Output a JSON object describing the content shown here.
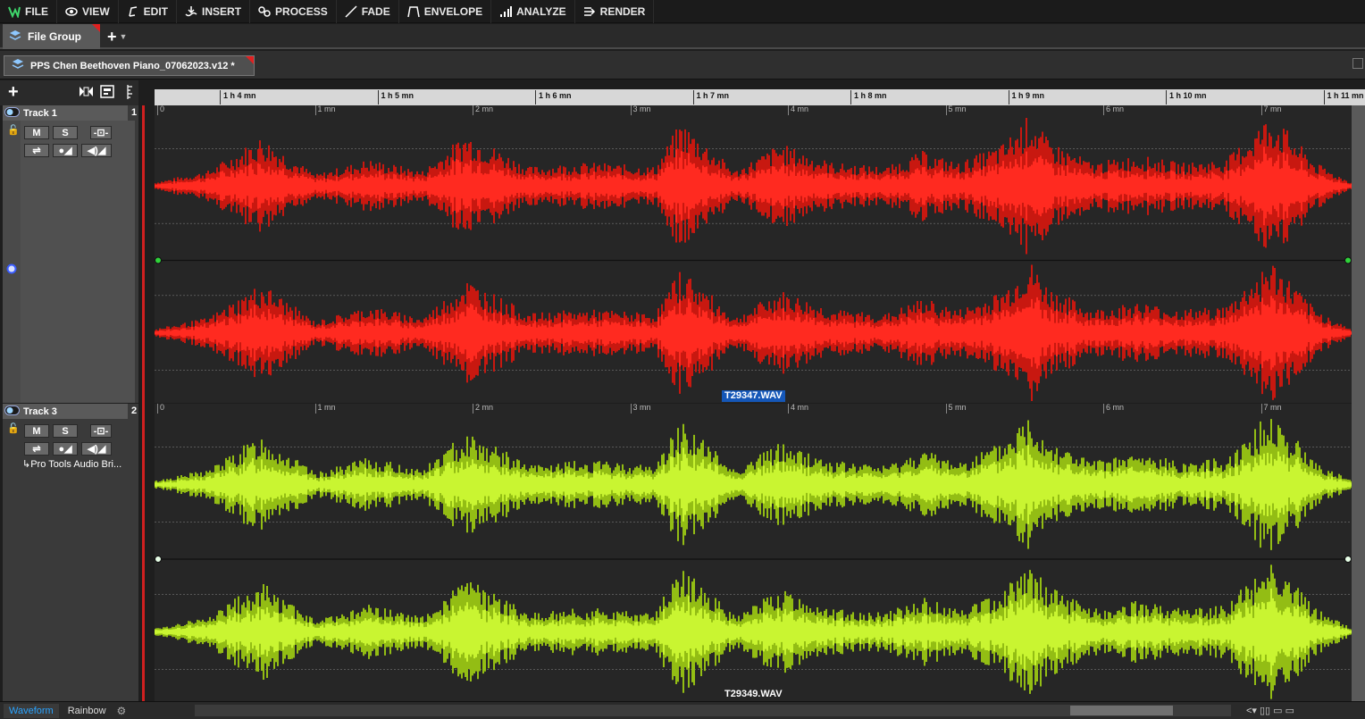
{
  "menu": [
    {
      "label": "FILE",
      "icon": "wavelab-logo-icon"
    },
    {
      "label": "VIEW",
      "icon": "eye-icon"
    },
    {
      "label": "EDIT",
      "icon": "edit-icon"
    },
    {
      "label": "INSERT",
      "icon": "insert-icon"
    },
    {
      "label": "PROCESS",
      "icon": "process-icon"
    },
    {
      "label": "FADE",
      "icon": "fade-icon"
    },
    {
      "label": "ENVELOPE",
      "icon": "envelope-icon"
    },
    {
      "label": "ANALYZE",
      "icon": "analyze-icon"
    },
    {
      "label": "RENDER",
      "icon": "render-icon"
    }
  ],
  "file_group_tab": {
    "label": "File Group"
  },
  "add_tab": {
    "label": "+"
  },
  "document_tab": {
    "label": "PPS Chen Beethoven Piano_07062023.v12 *"
  },
  "ruler": {
    "labels": [
      "1 h 4 mn",
      "1 h 5 mn",
      "1 h 6 mn",
      "1 h 7 mn",
      "1 h 8 mn",
      "1 h 9 mn",
      "1 h 10 mn",
      "1 h 11 mn"
    ]
  },
  "lane_ruler": {
    "labels": [
      "0",
      "1 mn",
      "2 mn",
      "3 mn",
      "4 mn",
      "5 mn",
      "6 mn",
      "7 mn"
    ]
  },
  "tracks": [
    {
      "name": "Track 1",
      "number": "1",
      "mute_label": "M",
      "solo_label": "S",
      "clip_label": "T29347.WAV",
      "color": "#ff2a20",
      "color_dark": "#c81810",
      "output": ""
    },
    {
      "name": "Track 3",
      "number": "2",
      "mute_label": "M",
      "solo_label": "S",
      "clip_label": "T29349.WAV",
      "color": "#c9f531",
      "color_dark": "#93bd14",
      "output": "↳Pro Tools Audio Bri..."
    }
  ],
  "bottom": {
    "waveform_label": "Waveform",
    "rainbow_label": "Rainbow"
  }
}
